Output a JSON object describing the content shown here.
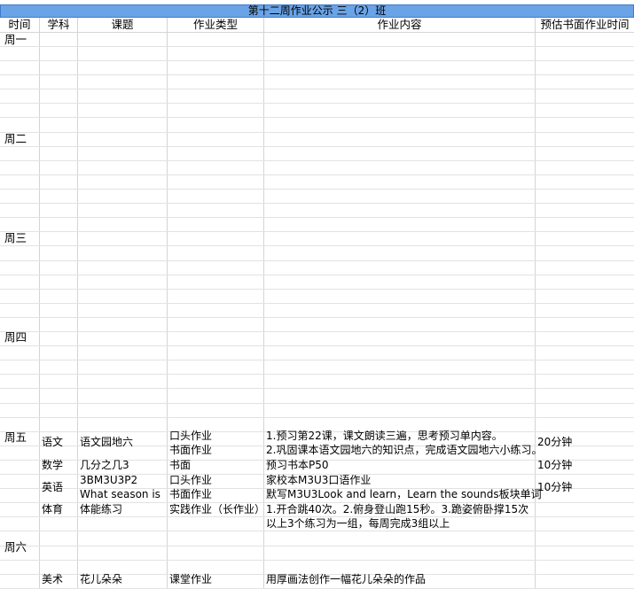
{
  "title": "第十二周作业公示 三（2）班",
  "headers": {
    "time": "时间",
    "subject": "学科",
    "topic": "课题",
    "type": "作业类型",
    "content": "作业内容",
    "estimate": "预估书面作业时间"
  },
  "days": {
    "mon": "周一",
    "tue": "周二",
    "wed": "周三",
    "thu": "周四",
    "fri": "周五",
    "sat": "周六"
  },
  "fri": {
    "chinese": {
      "subject": "语文",
      "topic": "语文园地六",
      "type1": "口头作业",
      "content1": "1.预习第22课，课文朗读三遍，思考预习单内容。",
      "type2": "书面作业",
      "content2": "2.巩固课本语文园地六的知识点，完成语文园地六小练习。",
      "time": "20分钟"
    },
    "math": {
      "subject": "数学",
      "topic": "几分之几3",
      "type": "书面",
      "content": "预习书本P50",
      "time": "10分钟"
    },
    "english": {
      "subject": "英语",
      "topic1": "3BM3U3P2",
      "topic2": "What season is",
      "type1": "口头作业",
      "content1": "家校本M3U3口语作业",
      "type2": "书面作业",
      "content2": "默写M3U3Look and learn，Learn the sounds板块单词",
      "time": "10分钟"
    },
    "pe": {
      "subject": "体育",
      "topic": "体能练习",
      "type": "实践作业（长作业）",
      "content1": "1.开合跳40次。2.俯身登山跑15秒。3.跪姿俯卧撑15次",
      "content2": "以上3个练习为一组，每周完成3组以上"
    }
  },
  "sat": {
    "art": {
      "subject": "美术",
      "topic": "花儿朵朵",
      "type": "课堂作业",
      "content": "用厚画法创作一幅花儿朵朵的作品"
    }
  }
}
